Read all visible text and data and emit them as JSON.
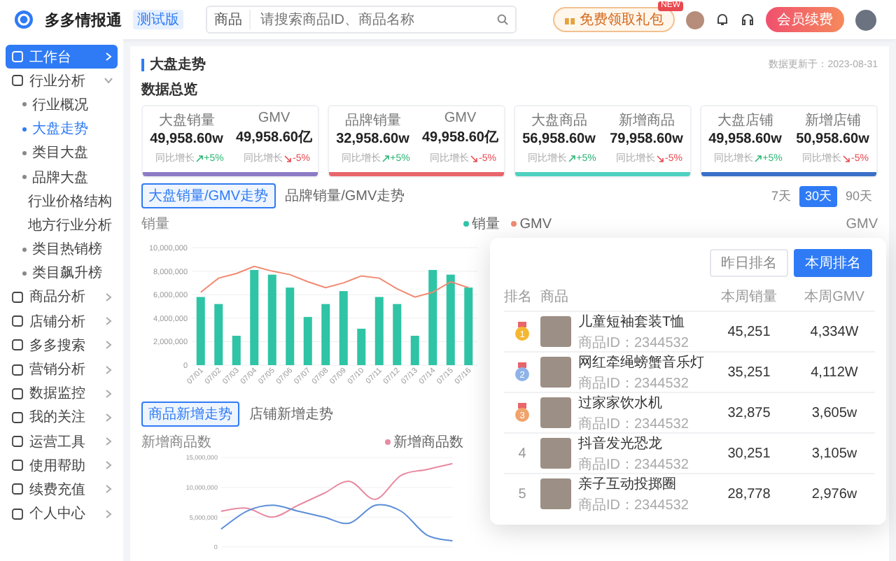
{
  "header": {
    "brand": "多多情报通",
    "version_badge": "测试版",
    "search": {
      "category": "商品",
      "placeholder": "请搜索商品ID、商品名称"
    },
    "gift_button": "免费领取礼包",
    "gift_badge": "NEW",
    "renew_button": "会员续费"
  },
  "sidebar": {
    "items": [
      {
        "label": "工作台",
        "selected": true,
        "expanded": false
      },
      {
        "label": "行业分析",
        "selected": false,
        "expanded": true,
        "children": [
          {
            "label": "行业概况",
            "selected": false
          },
          {
            "label": "大盘走势",
            "selected": true
          },
          {
            "label": "类目大盘",
            "selected": false
          },
          {
            "label": "品牌大盘",
            "selected": false
          },
          {
            "label": "行业价格结构",
            "selected": false
          },
          {
            "label": "地方行业分析",
            "selected": false
          },
          {
            "label": "类目热销榜",
            "selected": false
          },
          {
            "label": "类目飙升榜",
            "selected": false
          }
        ]
      },
      {
        "label": "商品分析",
        "selected": false,
        "expanded": false
      },
      {
        "label": "店铺分析",
        "selected": false,
        "expanded": false
      },
      {
        "label": "多多搜索",
        "selected": false,
        "expanded": false
      },
      {
        "label": "营销分析",
        "selected": false,
        "expanded": false
      },
      {
        "label": "数据监控",
        "selected": false,
        "expanded": false
      },
      {
        "label": "我的关注",
        "selected": false,
        "expanded": false
      },
      {
        "label": "运营工具",
        "selected": false,
        "expanded": false
      },
      {
        "label": "使用帮助",
        "selected": false,
        "expanded": false
      },
      {
        "label": "续费充值",
        "selected": false,
        "expanded": false
      },
      {
        "label": "个人中心",
        "selected": false,
        "expanded": false
      }
    ]
  },
  "page": {
    "title": "大盘走势",
    "updated": "数据更新于：2023-08-31",
    "overview_title": "数据总览"
  },
  "overview_cards": [
    {
      "color": "#8d7bc4",
      "metrics": [
        {
          "label": "大盘销量",
          "value": "49,958.60w",
          "compare": "同比增长",
          "up": true,
          "change": "+5%"
        },
        {
          "label": "GMV",
          "value": "49,958.60亿",
          "compare": "同比增长",
          "up": false,
          "change": "-5%"
        }
      ]
    },
    {
      "color": "#e8656b",
      "metrics": [
        {
          "label": "品牌销量",
          "value": "32,958.60w",
          "compare": "同比增长",
          "up": true,
          "change": "+5%"
        },
        {
          "label": "GMV",
          "value": "49,958.60亿",
          "compare": "同比增长",
          "up": false,
          "change": "-5%"
        }
      ]
    },
    {
      "color": "#4fd1c0",
      "metrics": [
        {
          "label": "大盘商品",
          "value": "56,958.60w",
          "compare": "同比增长",
          "up": true,
          "change": "+5%"
        },
        {
          "label": "新增商品",
          "value": "79,958.60w",
          "compare": "同比增长",
          "up": false,
          "change": "-5%"
        }
      ]
    },
    {
      "color": "#3a6fc8",
      "metrics": [
        {
          "label": "大盘店铺",
          "value": "49,958.60w",
          "compare": "同比增长",
          "up": true,
          "change": "+5%"
        },
        {
          "label": "新增店铺",
          "value": "50,958.60w",
          "compare": "同比增长",
          "up": false,
          "change": "-5%"
        }
      ]
    }
  ],
  "trend_tabs": [
    {
      "label": "大盘销量/GMV走势",
      "selected": true
    },
    {
      "label": "品牌销量/GMV走势",
      "selected": false
    }
  ],
  "period_buttons": [
    {
      "label": "7天",
      "selected": false
    },
    {
      "label": "30天",
      "selected": true
    },
    {
      "label": "90天",
      "selected": false
    }
  ],
  "sales_chart": {
    "right_axis_label": "GMV",
    "chart_data": {
      "type": "bar",
      "ylabel": "销量",
      "ylim": [
        0,
        10000000
      ],
      "grid": true,
      "stacked": false,
      "yticks": [
        {
          "value": 0,
          "label": "0"
        },
        {
          "value": 2000000,
          "label": "2,000,000"
        },
        {
          "value": 4000000,
          "label": "4,000,000"
        },
        {
          "value": 6000000,
          "label": "6,000,000"
        },
        {
          "value": 8000000,
          "label": "8,000,000"
        },
        {
          "value": 10000000,
          "label": "10,000,000"
        }
      ],
      "categories": [
        "07/01",
        "07/02",
        "07/03",
        "07/04",
        "07/05",
        "07/06",
        "07/07",
        "07/08",
        "07/09",
        "07/10",
        "07/11",
        "07/12",
        "07/13",
        "07/14",
        "07/15",
        "07/16"
      ],
      "series": [
        {
          "name": "销量",
          "color": "#2ec4a5",
          "values": [
            5800000,
            5200000,
            2500000,
            8100000,
            7700000,
            6600000,
            4100000,
            5200000,
            6300000,
            3100000,
            5800000,
            5200000,
            2500000,
            8100000,
            7700000,
            6600000
          ]
        },
        {
          "name": "GMV",
          "type": "line",
          "color": "#f08a72",
          "values": [
            6200000,
            7400000,
            7800000,
            8400000,
            8000000,
            7700000,
            7100000,
            6600000,
            7000000,
            7600000,
            7400000,
            6500000,
            5800000,
            6200000,
            7100000,
            6600000
          ]
        }
      ]
    }
  },
  "new_tabs": [
    {
      "label": "商品新增走势",
      "selected": true
    },
    {
      "label": "店铺新增走势",
      "selected": false
    }
  ],
  "new_chart": {
    "chart_data": {
      "type": "line",
      "ylabel": "新增商品数",
      "ylim": [
        0,
        15000000
      ],
      "grid": true,
      "yticks": [
        {
          "value": 0,
          "label": "0"
        },
        {
          "value": 5000000,
          "label": "5,000,000"
        },
        {
          "value": 10000000,
          "label": "10,000,000"
        },
        {
          "value": 15000000,
          "label": "15,000,000"
        }
      ],
      "series": [
        {
          "name": "新增商品数",
          "color": "#e88aa0",
          "values": [
            6000000,
            6500000,
            5000000,
            7000000,
            9000000,
            11000000,
            8000000,
            12000000,
            13000000,
            14000000
          ]
        },
        {
          "color": "#5b8ed8",
          "values": [
            3000000,
            6000000,
            7000000,
            6000000,
            5000000,
            4000000,
            7000000,
            6000000,
            2000000,
            1000000
          ]
        }
      ]
    }
  },
  "ranking": {
    "buttons": [
      {
        "label": "昨日排名",
        "selected": false
      },
      {
        "label": "本周排名",
        "selected": true
      }
    ],
    "columns": [
      "排名",
      "商品",
      "本周销量",
      "本周GMV"
    ],
    "rows": [
      {
        "kind": "medal",
        "rank": "1",
        "color": "#f5b731",
        "name": "儿童短袖套装T恤",
        "id": "商品ID：2344532",
        "sales": "45,251",
        "gmv": "4,334W"
      },
      {
        "kind": "medal",
        "rank": "2",
        "color": "#8fb3e8",
        "name": "网红牵绳螃蟹音乐灯",
        "id": "商品ID：2344532",
        "sales": "35,251",
        "gmv": "4,112W"
      },
      {
        "kind": "medal",
        "rank": "3",
        "color": "#f0a36a",
        "name": "过家家饮水机",
        "id": "商品ID：2344532",
        "sales": "32,875",
        "gmv": "3,605w"
      },
      {
        "kind": "plain",
        "rank": "4",
        "name": "抖音发光恐龙",
        "id": "商品ID：2344532",
        "sales": "30,251",
        "gmv": "3,105w"
      },
      {
        "kind": "plain",
        "rank": "5",
        "name": "亲子互动投掷圈",
        "id": "商品ID：2344532",
        "sales": "28,778",
        "gmv": "2,976w"
      }
    ]
  }
}
